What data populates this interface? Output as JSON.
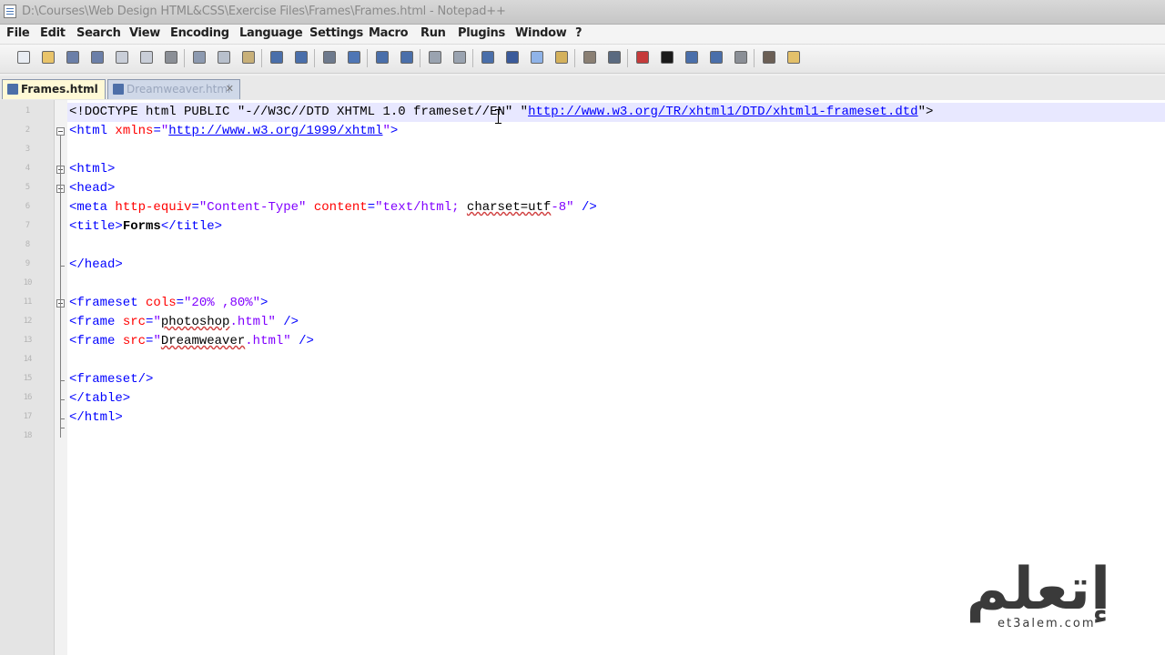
{
  "window": {
    "title": "D:\\Courses\\Web Design HTML&CSS\\Exercise Files\\Frames\\Frames.html - Notepad++"
  },
  "menu": [
    "File",
    "Edit",
    "Search",
    "View",
    "Encoding",
    "Language",
    "Settings",
    "Macro",
    "Run",
    "Plugins",
    "Window",
    "?"
  ],
  "toolbar": {
    "buttons": [
      {
        "icon": "new-file-icon",
        "color": "#e9edf3"
      },
      {
        "icon": "open-file-icon",
        "color": "#e9c46a"
      },
      {
        "icon": "save-icon",
        "color": "#6b7fa8"
      },
      {
        "icon": "save-all-icon",
        "color": "#6b7fa8"
      },
      {
        "icon": "close-icon",
        "color": "#c9ced8"
      },
      {
        "icon": "close-all-icon",
        "color": "#c9ced8"
      },
      {
        "icon": "print-icon",
        "color": "#8b8f96"
      },
      {
        "icon": "cut-icon",
        "color": "#8d9ab0"
      },
      {
        "icon": "copy-icon",
        "color": "#b8c0cc"
      },
      {
        "icon": "paste-icon",
        "color": "#c8b079"
      },
      {
        "icon": "undo-icon",
        "color": "#4a6faa"
      },
      {
        "icon": "redo-icon",
        "color": "#4a6faa"
      },
      {
        "icon": "find-icon",
        "color": "#6e7a8d"
      },
      {
        "icon": "replace-icon",
        "color": "#4f76b5"
      },
      {
        "icon": "zoom-in-icon",
        "color": "#4a6faa"
      },
      {
        "icon": "zoom-out-icon",
        "color": "#4a6faa"
      },
      {
        "icon": "sync-vertical-icon",
        "color": "#9aa3b0"
      },
      {
        "icon": "sync-horizontal-icon",
        "color": "#9aa3b0"
      },
      {
        "icon": "word-wrap-icon",
        "color": "#4a6faa"
      },
      {
        "icon": "show-all-chars-icon",
        "color": "#3a5a9a"
      },
      {
        "icon": "indent-guide-icon",
        "color": "#8fb3e8"
      },
      {
        "icon": "user-lang-icon",
        "color": "#d4b15c"
      },
      {
        "icon": "doc-map-icon",
        "color": "#8a7f73"
      },
      {
        "icon": "function-list-icon",
        "color": "#5a6a80"
      },
      {
        "icon": "record-macro-icon",
        "color": "#c53b3b"
      },
      {
        "icon": "stop-record-icon",
        "color": "#1a1a1a"
      },
      {
        "icon": "play-macro-icon",
        "color": "#4a6faa"
      },
      {
        "icon": "run-macro-multiple-icon",
        "color": "#4a6faa"
      },
      {
        "icon": "save-macro-icon",
        "color": "#8b8f96"
      },
      {
        "icon": "spellcheck-icon",
        "color": "#6b5f55"
      },
      {
        "icon": "folder-icon",
        "color": "#e3c06a"
      }
    ]
  },
  "tabs": [
    {
      "label": "Frames.html",
      "active": true
    },
    {
      "label": "Dreamweaver.html",
      "active": false
    }
  ],
  "editor": {
    "line_numbers": [
      "1",
      "2",
      "3",
      "4",
      "5",
      "6",
      "7",
      "8",
      "9",
      "10",
      "11",
      "12",
      "13",
      "14",
      "15",
      "16",
      "17",
      "18"
    ],
    "lines": [
      [
        [
          "doc",
          "<!DOCTYPE html PUBLIC \"-//W3C//DTD XHTML 1.0 frameset//EN\" \""
        ],
        [
          "link",
          "http://www.w3.org/TR/xhtml1/DTD/xhtml1-frameset.dtd"
        ],
        [
          "doc",
          "\">"
        ]
      ],
      [
        [
          "t",
          "<html "
        ],
        [
          "a",
          "xmlns"
        ],
        [
          "t",
          "="
        ],
        [
          "v",
          "\""
        ],
        [
          "link",
          "http://www.w3.org/1999/xhtml"
        ],
        [
          "v",
          "\""
        ],
        [
          "t",
          ">"
        ]
      ],
      [],
      [
        [
          "t",
          "<html>"
        ]
      ],
      [
        [
          "t",
          "<head>"
        ]
      ],
      [
        [
          "t",
          "<meta "
        ],
        [
          "a",
          "http-equiv"
        ],
        [
          "t",
          "="
        ],
        [
          "v",
          "\"Content-Type\" "
        ],
        [
          "a",
          "content"
        ],
        [
          "t",
          "="
        ],
        [
          "v",
          "\"text/html; "
        ],
        [
          "sq",
          "charset=utf"
        ],
        [
          "v",
          "-8\" "
        ],
        [
          "t",
          "/>"
        ]
      ],
      [
        [
          "t",
          "<title>"
        ],
        [
          "txt",
          "Forms"
        ],
        [
          "t",
          "</title>"
        ]
      ],
      [],
      [
        [
          "t",
          "</head>"
        ]
      ],
      [],
      [
        [
          "t",
          "<frameset "
        ],
        [
          "a",
          "cols"
        ],
        [
          "t",
          "="
        ],
        [
          "v",
          "\"20% ,80%\""
        ],
        [
          "t",
          ">"
        ]
      ],
      [
        [
          "t",
          "<frame "
        ],
        [
          "a",
          "src"
        ],
        [
          "t",
          "="
        ],
        [
          "v",
          "\""
        ],
        [
          "sq",
          "photoshop"
        ],
        [
          "v",
          ".html\" "
        ],
        [
          "t",
          "/>"
        ]
      ],
      [
        [
          "t",
          "<frame "
        ],
        [
          "a",
          "src"
        ],
        [
          "t",
          "="
        ],
        [
          "v",
          "\""
        ],
        [
          "sq",
          "Dreamweaver"
        ],
        [
          "v",
          ".html\" "
        ],
        [
          "t",
          "/>"
        ]
      ],
      [],
      [
        [
          "t",
          "<frameset/>"
        ]
      ],
      [
        [
          "t",
          "</table>"
        ]
      ],
      [
        [
          "t",
          "</html>"
        ]
      ],
      []
    ]
  },
  "watermark": {
    "arabic": "إتعلم",
    "url": "et3alem.com"
  }
}
